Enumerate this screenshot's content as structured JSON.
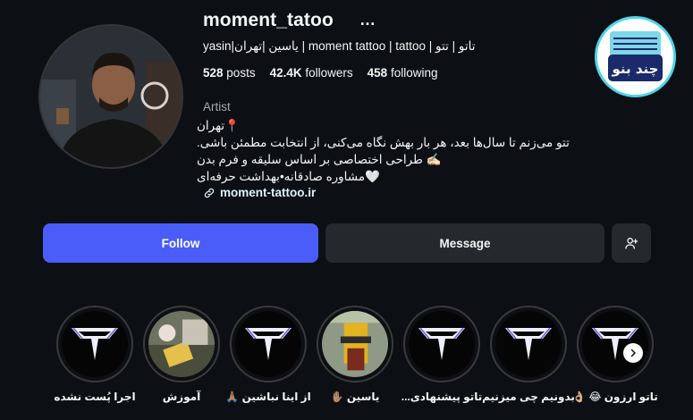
{
  "profile": {
    "username": "moment_tatoo",
    "more_icon": "…",
    "full_name": "yasin|یاسین |تهران | moment tattoo | tattoo | تاتو | تتو",
    "stats": {
      "posts": "528",
      "posts_label": "posts",
      "followers": "42.4K",
      "followers_label": "followers",
      "following": "458",
      "following_label": "following"
    },
    "category": "Artist",
    "bio": [
      "📍تهران",
      "تتو می‌زنم تا سال‌ها بعد، هر بار بهش نگاه می‌کنی، از انتخابت مطمئن باشی.",
      "✍🏻 طراحی اختصاصی بر اساس سلیقه و فرم بدن",
      "🤍مشاوره صادقانه•بهداشت حرفه‌ای"
    ],
    "link": "moment-tattoo.ir",
    "link_icon": "link-icon"
  },
  "badge": {
    "text": "چند بنو",
    "colors": {
      "ring": "#4fd4e9",
      "body": "#1a2a6b",
      "top": "#7fd6e8"
    }
  },
  "actions": {
    "follow": "Follow",
    "message": "Message",
    "add_icon": "person-add-icon"
  },
  "highlights": [
    {
      "label": "اجرا پُست نشده",
      "kind": "logo"
    },
    {
      "label": "آموزش",
      "kind": "photo"
    },
    {
      "label": "از اینا نباشین 🙏🏽",
      "kind": "logo"
    },
    {
      "label": "یاسین ✋🏽",
      "kind": "photo"
    },
    {
      "label": "تاتو پیشنهادی...",
      "kind": "logo"
    },
    {
      "label": "بدونیم چی میزنیم",
      "kind": "logo"
    },
    {
      "label": "تاتو ارزون 😂 👌🏼",
      "kind": "logo"
    }
  ],
  "colors": {
    "background": "#0c1014",
    "follow_button": "#4a5df9",
    "secondary_button": "#25292e",
    "link": "#e0f1ff"
  }
}
